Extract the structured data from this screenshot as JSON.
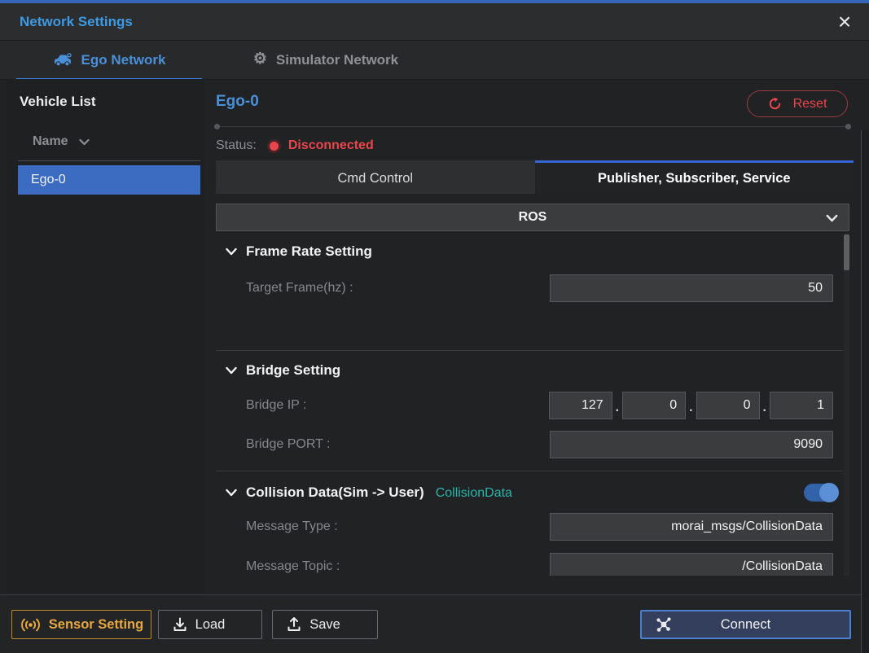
{
  "window": {
    "title": "Network Settings",
    "close_icon": "×"
  },
  "icons": {
    "gear_glyph": "⚙"
  },
  "tabs": [
    {
      "label": "Ego Network",
      "icon": "car-icon",
      "active": true
    },
    {
      "label": "Simulator Network",
      "icon": "gear-icon",
      "active": false
    }
  ],
  "vehicle_list": {
    "title": "Vehicle List",
    "column_header": "Name",
    "rows": [
      {
        "name": "Ego-0",
        "selected": true
      }
    ]
  },
  "main": {
    "vehicle_title": "Ego-0",
    "reset_label": "Reset",
    "status_label": "Status:",
    "status_value": "Disconnected",
    "subtabs": [
      {
        "label": "Cmd Control",
        "active": false
      },
      {
        "label": "Publisher, Subscriber, Service",
        "active": true
      }
    ],
    "protocol": "ROS",
    "ip_separator": ".",
    "sections": [
      {
        "title": "Frame Rate Setting",
        "rows": [
          {
            "label": "Target Frame(hz) :",
            "value": "50"
          }
        ]
      },
      {
        "title": "Bridge Setting",
        "rows": [
          {
            "label": "Bridge IP :",
            "octets": [
              "127",
              "0",
              "0",
              "1"
            ]
          },
          {
            "label": "Bridge PORT :",
            "value": "9090"
          }
        ]
      },
      {
        "title": "Collision Data(Sim -> User)",
        "tag": "CollisionData",
        "toggle_on": true,
        "rows": [
          {
            "label": "Message Type :",
            "value": "morai_msgs/CollisionData"
          },
          {
            "label": "Message Topic :",
            "value": "/CollisionData"
          }
        ]
      }
    ]
  },
  "footer": {
    "sensor_setting_label": "Sensor Setting",
    "load_label": "Load",
    "save_label": "Save",
    "connect_label": "Connect"
  },
  "colors": {
    "accent_blue": "#3f9ae4",
    "tab_blue": "#4a90d9",
    "selection_blue": "#3b6cc1",
    "subtab_active_border": "#3565d2",
    "error_red": "#e8464c",
    "warning_orange": "#e7a93e",
    "teal_tag": "#2eb3ab",
    "toggle_track": "#3263a8",
    "toggle_knob": "#5b8fd6",
    "connect_bg": "#343f5e",
    "connect_border": "#4a7fd0",
    "input_bg": "#3a3c3e"
  }
}
